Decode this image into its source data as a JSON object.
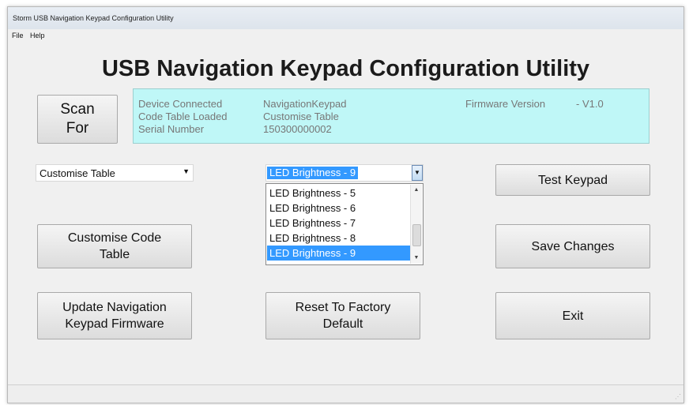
{
  "window": {
    "title": "Storm USB Navigation Keypad Configuration Utility"
  },
  "menu": {
    "file": "File",
    "help": "Help"
  },
  "app_title": "USB Navigation Keypad Configuration Utility",
  "scan_button": {
    "line1": "Scan",
    "line2": "For"
  },
  "info": {
    "device_label": "Device Connected",
    "device_value": "NavigationKeypad",
    "table_label": "Code Table Loaded",
    "table_value": "Customise Table",
    "serial_label": "Serial Number",
    "serial_value": "150300000002",
    "firmware_label": "Firmware Version",
    "firmware_value": "-  V1.0"
  },
  "code_table_select": {
    "value": "Customise Table"
  },
  "brightness_select": {
    "value": "LED Brightness - 9",
    "options": [
      "LED Brightness - 5",
      "LED Brightness - 6",
      "LED Brightness - 7",
      "LED Brightness - 8",
      "LED Brightness - 9"
    ]
  },
  "buttons": {
    "test_keypad": "Test Keypad",
    "customise_line1": "Customise Code",
    "customise_line2": "Table",
    "save_changes": "Save Changes",
    "update_line1": "Update Navigation",
    "update_line2": "Keypad Firmware",
    "reset_line1": "Reset To Factory",
    "reset_line2": "Default",
    "exit": "Exit"
  },
  "colors": {
    "info_panel_bg": "#bff7f7",
    "selection": "#3399ff"
  }
}
